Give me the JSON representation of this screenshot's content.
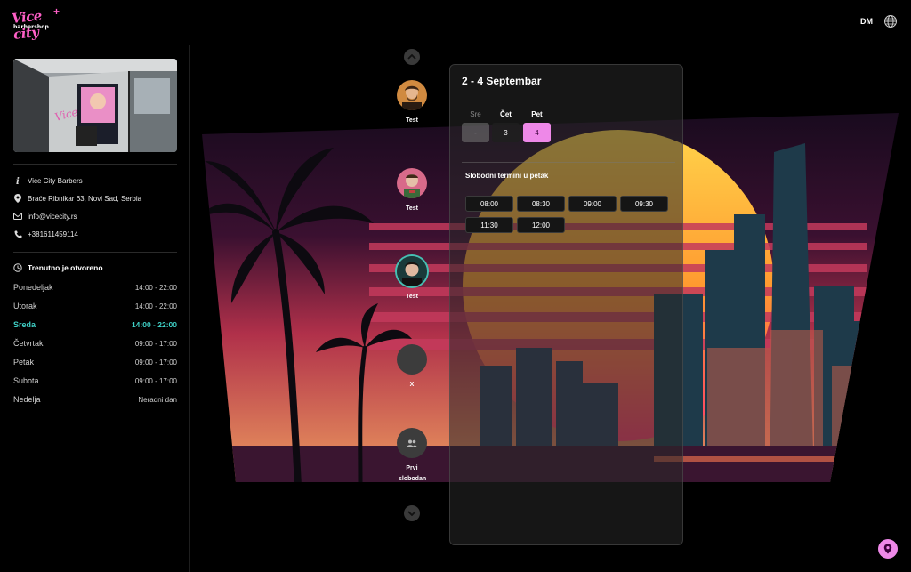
{
  "header": {
    "logo_line1": "Vice city",
    "logo_line2": "barbershop",
    "logo_plus": "+",
    "language": "DM",
    "globe_icon": "globe-icon"
  },
  "sidebar": {
    "shop_name": "Vice City Barbers",
    "address": "Braće Ribnikar 63, Novi Sad, Serbia",
    "email": "info@vicecity.rs",
    "phone": "+381611459114",
    "status": "Trenutno je otvoreno",
    "hours": [
      {
        "day": "Ponedeljak",
        "time": "14:00 - 22:00",
        "today": false
      },
      {
        "day": "Utorak",
        "time": "14:00 - 22:00",
        "today": false
      },
      {
        "day": "Sreda",
        "time": "14:00 - 22:00",
        "today": true
      },
      {
        "day": "Četvrtak",
        "time": "09:00 - 17:00",
        "today": false
      },
      {
        "day": "Petak",
        "time": "09:00 - 17:00",
        "today": false
      },
      {
        "day": "Subota",
        "time": "09:00 - 17:00",
        "today": false
      },
      {
        "day": "Nedelja",
        "time": "Neradni dan",
        "today": false
      }
    ]
  },
  "barbers": [
    {
      "name": "Test",
      "selected": false
    },
    {
      "name": "Test",
      "selected": false
    },
    {
      "name": "Test",
      "selected": true
    },
    {
      "name": "X",
      "selected": false
    },
    {
      "name": "Prvi slobodan",
      "selected": false
    }
  ],
  "booking": {
    "title": "2 - 4 Septembar",
    "days": [
      {
        "name": "Sre",
        "value": "-",
        "state": "disabled"
      },
      {
        "name": "Čet",
        "value": "3",
        "state": "normal"
      },
      {
        "name": "Pet",
        "value": "4",
        "state": "active"
      }
    ],
    "slots_title": "Slobodni termini u petak",
    "slots": [
      "08:00",
      "08:30",
      "09:00",
      "09:30",
      "11:30",
      "12:00"
    ]
  },
  "colors": {
    "accent_pink": "#ee88e8",
    "accent_teal": "#3fd0c6",
    "background": "#000000"
  }
}
